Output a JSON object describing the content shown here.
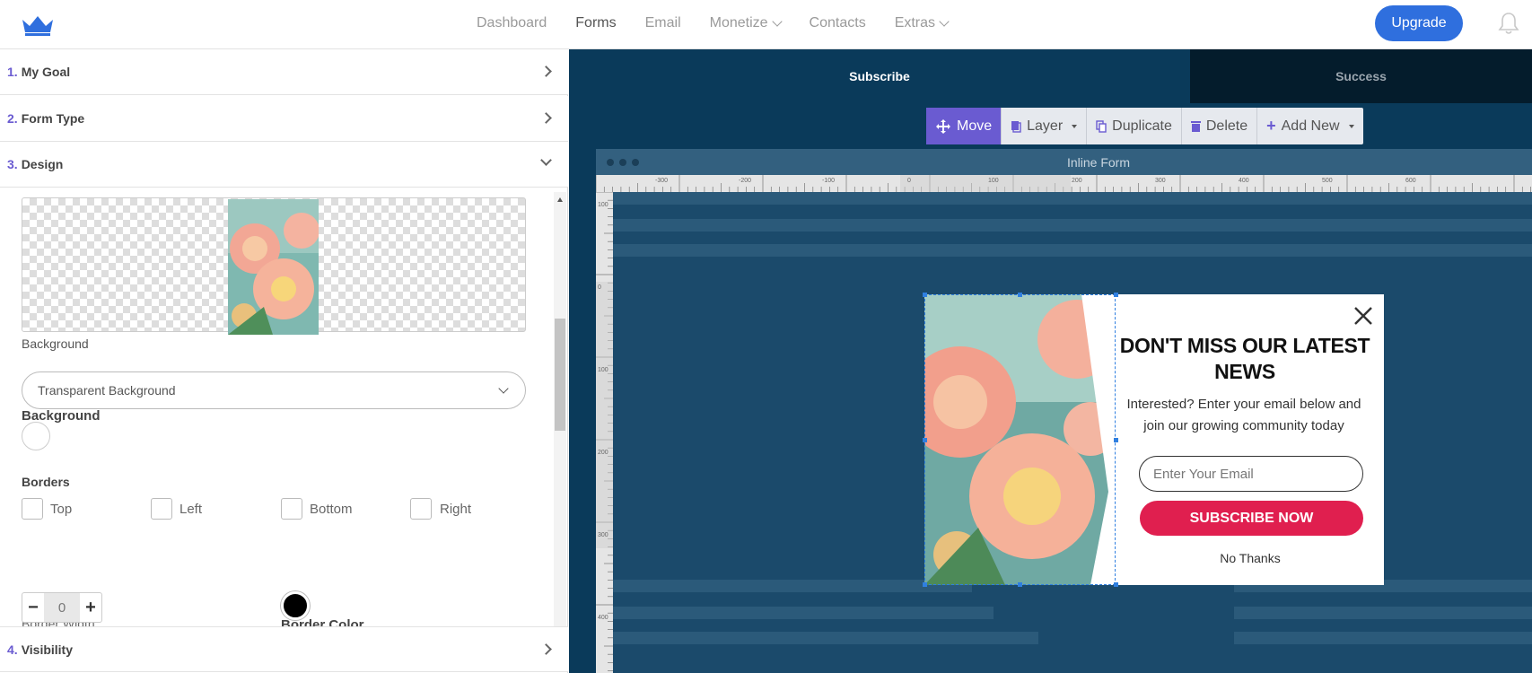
{
  "nav": {
    "links": [
      {
        "label": "Dashboard",
        "has_caret": false,
        "active": false
      },
      {
        "label": "Forms",
        "has_caret": false,
        "active": true
      },
      {
        "label": "Email",
        "has_caret": false,
        "active": false
      },
      {
        "label": "Monetize",
        "has_caret": true,
        "active": false
      },
      {
        "label": "Contacts",
        "has_caret": false,
        "active": false
      },
      {
        "label": "Extras",
        "has_caret": true,
        "active": false
      }
    ],
    "upgrade_label": "Upgrade",
    "logo_icon": "crown-icon",
    "notification_icon": "bell-icon",
    "accent": "#2f6fde"
  },
  "accordion": {
    "step1": {
      "num": "1.",
      "title": "My Goal"
    },
    "step2": {
      "num": "2.",
      "title": "Form Type"
    },
    "step3": {
      "num": "3.",
      "title": "Design"
    },
    "step4": {
      "num": "4.",
      "title": "Visibility"
    }
  },
  "design": {
    "background_label": "Background",
    "background_select_value": "Transparent Background",
    "background_color_label": "Background",
    "borders_label": "Borders",
    "border_options": [
      "Top",
      "Left",
      "Bottom",
      "Right"
    ],
    "border_width_label": "Border Width",
    "border_width_value": "0",
    "border_color_label": "Border Color",
    "background_color": "#ffffff",
    "border_color": "#000000"
  },
  "editor": {
    "tabs": {
      "subscribe": "Subscribe",
      "success": "Success"
    },
    "toolbar": {
      "move": "Move",
      "layer": "Layer",
      "duplicate": "Duplicate",
      "delete": "Delete",
      "add_new": "Add New"
    },
    "frame_title": "Inline Form",
    "ruler_h_labels": [
      "-300",
      "-200",
      "-100",
      "0",
      "100",
      "200",
      "300",
      "400",
      "500",
      "600"
    ],
    "ruler_v_labels": [
      "100",
      "0",
      "100",
      "200",
      "300",
      "400"
    ]
  },
  "popup": {
    "title": "DON'T MISS OUR LATEST NEWS",
    "subtitle": "Interested? Enter your email below and join our growing community today",
    "email_placeholder": "Enter Your Email",
    "subscribe_label": "SUBSCRIBE NOW",
    "dismiss_label": "No Thanks",
    "button_color": "#e01f4f"
  }
}
